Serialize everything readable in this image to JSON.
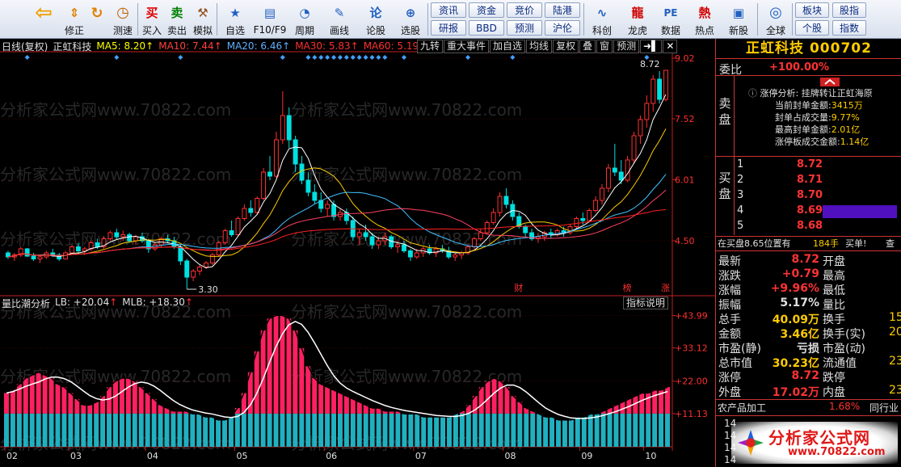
{
  "toolbar": {
    "buttons": [
      {
        "label": "",
        "icon": "back-arrow-icon",
        "glyph": "⇦"
      },
      {
        "label": "修正",
        "icon": "up-down-arrows-icon",
        "glyph": "⇕"
      },
      {
        "label": "测速",
        "icon": "refresh-circle-icon",
        "glyph": "↻"
      },
      {
        "label": "测速",
        "icon": "clock-icon",
        "glyph": "◷"
      },
      {
        "label": "买入",
        "icon": "buy-icon",
        "glyph": "买"
      },
      {
        "label": "卖出",
        "icon": "sell-icon",
        "glyph": "卖"
      },
      {
        "label": "模拟",
        "icon": "hammer-icon",
        "glyph": "⚒"
      },
      {
        "label": "自选",
        "icon": "star-icon",
        "glyph": "★"
      },
      {
        "label": "F10/F9",
        "icon": "document-icon",
        "glyph": "▤"
      },
      {
        "label": "周期",
        "icon": "period-clock-icon",
        "glyph": "◔"
      },
      {
        "label": "画线",
        "icon": "pencil-icon",
        "glyph": "✎"
      },
      {
        "label": "论股",
        "icon": "discuss-icon",
        "glyph": "论"
      },
      {
        "label": "选股",
        "icon": "magnifier-icon",
        "glyph": "⊕"
      },
      {
        "label": "科创",
        "icon": "chart-icon",
        "glyph": "∿"
      },
      {
        "label": "龙虎",
        "icon": "dragon-icon",
        "glyph": "龍"
      },
      {
        "label": "数据",
        "icon": "pe-icon",
        "glyph": "PE"
      },
      {
        "label": "热点",
        "icon": "hot-icon",
        "glyph": "熱"
      },
      {
        "label": "新股",
        "icon": "new-stock-icon",
        "glyph": "▣"
      },
      {
        "label": "全球",
        "icon": "globe-icon",
        "glyph": "◎"
      }
    ],
    "small_buttons": [
      {
        "label": "资讯"
      },
      {
        "label": "资金"
      },
      {
        "label": "竞价"
      },
      {
        "label": "陆港"
      },
      {
        "label": "研报"
      },
      {
        "label": "BBD"
      },
      {
        "label": "预测"
      },
      {
        "label": "沪伦"
      },
      {
        "label": "板块"
      },
      {
        "label": "股指"
      },
      {
        "label": "个股"
      },
      {
        "label": "指数"
      }
    ]
  },
  "chart_data": [
    {
      "type": "candlestick",
      "period_label": "日线(复权)",
      "stock_name": "正虹科技",
      "ma": [
        {
          "name": "MA5",
          "value": "8.20",
          "color": "#ffff00"
        },
        {
          "name": "MA10",
          "value": "7.44",
          "color": "#ff4040"
        },
        {
          "name": "MA20",
          "value": "6.46",
          "color": "#60b0ff"
        },
        {
          "name": "MA30",
          "value": "5.83",
          "color": "#ff3030"
        },
        {
          "name": "MA60",
          "value": "5.19",
          "color": "#ff3030"
        }
      ],
      "y_ticks": [
        "9.02",
        "7.52",
        "6.01",
        "4.50"
      ],
      "x_ticks": [
        "02",
        "03",
        "04",
        "05",
        "06",
        "07",
        "08",
        "09",
        "10"
      ],
      "high_label": "8.72",
      "low_label": "3.30",
      "markers": [
        "财",
        "榜",
        "涨"
      ],
      "ylim": [
        3.2,
        9.1
      ],
      "points": [
        [
          0,
          4.2,
          4.25,
          4.05,
          4.1
        ],
        [
          1,
          4.1,
          4.2,
          4.0,
          4.15
        ],
        [
          2,
          4.15,
          4.35,
          4.1,
          4.3
        ],
        [
          3,
          4.3,
          4.32,
          4.1,
          4.12
        ],
        [
          4,
          4.12,
          4.2,
          4.0,
          4.05
        ],
        [
          5,
          4.05,
          4.15,
          3.95,
          4.1
        ],
        [
          6,
          4.1,
          4.25,
          4.05,
          4.2
        ],
        [
          7,
          4.2,
          4.3,
          4.1,
          4.15
        ],
        [
          8,
          4.15,
          4.2,
          4.0,
          4.05
        ],
        [
          9,
          4.05,
          4.25,
          4.05,
          4.2
        ],
        [
          10,
          4.2,
          4.4,
          4.15,
          4.35
        ],
        [
          11,
          4.35,
          4.45,
          4.2,
          4.25
        ],
        [
          12,
          4.25,
          4.35,
          4.15,
          4.3
        ],
        [
          13,
          4.3,
          4.5,
          4.25,
          4.45
        ],
        [
          14,
          4.45,
          4.55,
          4.3,
          4.35
        ],
        [
          15,
          4.35,
          4.6,
          4.3,
          4.55
        ],
        [
          16,
          4.55,
          4.75,
          4.5,
          4.7
        ],
        [
          17,
          4.7,
          4.8,
          4.55,
          4.6
        ],
        [
          18,
          4.6,
          4.75,
          4.5,
          4.65
        ],
        [
          19,
          4.65,
          4.7,
          4.45,
          4.5
        ],
        [
          20,
          4.5,
          4.65,
          4.4,
          4.6
        ],
        [
          21,
          4.6,
          4.7,
          4.45,
          4.5
        ],
        [
          22,
          4.5,
          4.55,
          4.2,
          4.3
        ],
        [
          23,
          4.3,
          4.45,
          4.25,
          4.4
        ],
        [
          24,
          4.4,
          4.6,
          4.35,
          4.55
        ],
        [
          25,
          4.55,
          4.65,
          4.45,
          4.5
        ],
        [
          26,
          4.5,
          4.6,
          4.3,
          4.35
        ],
        [
          27,
          4.35,
          4.4,
          3.9,
          4.0
        ],
        [
          28,
          4.0,
          4.05,
          3.3,
          3.6
        ],
        [
          29,
          3.6,
          3.8,
          3.5,
          3.75
        ],
        [
          30,
          3.75,
          3.9,
          3.65,
          3.85
        ],
        [
          31,
          3.85,
          4.0,
          3.8,
          3.95
        ],
        [
          32,
          3.95,
          4.2,
          3.9,
          4.15
        ],
        [
          33,
          4.15,
          4.5,
          4.1,
          4.45
        ],
        [
          34,
          4.45,
          4.8,
          4.4,
          4.75
        ],
        [
          35,
          4.75,
          5.0,
          4.6,
          4.65
        ],
        [
          36,
          4.65,
          5.1,
          4.6,
          5.05
        ],
        [
          37,
          5.05,
          5.4,
          5.0,
          5.3
        ],
        [
          38,
          5.3,
          5.5,
          5.1,
          5.2
        ],
        [
          39,
          5.2,
          5.6,
          5.15,
          5.55
        ],
        [
          40,
          5.55,
          6.3,
          5.5,
          6.2
        ],
        [
          41,
          6.2,
          6.6,
          6.0,
          6.1
        ],
        [
          42,
          6.1,
          7.2,
          6.05,
          7.0
        ],
        [
          43,
          7.0,
          8.2,
          6.9,
          7.6
        ],
        [
          44,
          7.6,
          7.8,
          6.8,
          7.0
        ],
        [
          45,
          7.0,
          7.1,
          6.2,
          6.4
        ],
        [
          46,
          6.4,
          6.6,
          5.9,
          6.0
        ],
        [
          47,
          6.0,
          6.2,
          5.6,
          5.7
        ],
        [
          48,
          5.7,
          5.9,
          5.4,
          5.5
        ],
        [
          49,
          5.5,
          5.7,
          5.2,
          5.3
        ],
        [
          50,
          5.3,
          5.5,
          5.1,
          5.4
        ],
        [
          51,
          5.4,
          5.5,
          5.0,
          5.1
        ],
        [
          52,
          5.1,
          5.3,
          5.0,
          5.2
        ],
        [
          53,
          5.2,
          5.3,
          4.9,
          5.0
        ],
        [
          54,
          5.0,
          5.1,
          4.5,
          4.6
        ],
        [
          55,
          4.6,
          4.8,
          4.4,
          4.7
        ],
        [
          56,
          4.7,
          4.9,
          4.5,
          4.6
        ],
        [
          57,
          4.6,
          4.7,
          4.3,
          4.4
        ],
        [
          58,
          4.4,
          4.6,
          4.3,
          4.5
        ],
        [
          59,
          4.5,
          4.7,
          4.4,
          4.6
        ],
        [
          60,
          4.6,
          4.65,
          4.3,
          4.35
        ],
        [
          61,
          4.35,
          4.5,
          4.2,
          4.4
        ],
        [
          62,
          4.4,
          4.5,
          4.2,
          4.25
        ],
        [
          63,
          4.25,
          4.3,
          4.0,
          4.1
        ],
        [
          64,
          4.1,
          4.3,
          4.05,
          4.2
        ],
        [
          65,
          4.2,
          4.35,
          4.1,
          4.3
        ],
        [
          66,
          4.3,
          4.4,
          4.15,
          4.2
        ],
        [
          67,
          4.2,
          4.35,
          4.1,
          4.3
        ],
        [
          68,
          4.3,
          4.4,
          4.2,
          4.25
        ],
        [
          69,
          4.25,
          4.35,
          4.05,
          4.1
        ],
        [
          70,
          4.1,
          4.2,
          4.0,
          4.15
        ],
        [
          71,
          4.15,
          4.25,
          4.05,
          4.2
        ],
        [
          72,
          4.2,
          4.4,
          4.15,
          4.35
        ],
        [
          73,
          4.35,
          4.6,
          4.3,
          4.55
        ],
        [
          74,
          4.55,
          4.8,
          4.5,
          4.7
        ],
        [
          75,
          4.7,
          5.0,
          4.65,
          4.95
        ],
        [
          76,
          4.95,
          5.3,
          4.9,
          5.2
        ],
        [
          77,
          5.2,
          5.7,
          5.1,
          5.6
        ],
        [
          78,
          5.6,
          5.8,
          5.3,
          5.4
        ],
        [
          79,
          5.4,
          5.5,
          5.0,
          5.1
        ],
        [
          80,
          5.1,
          5.2,
          4.8,
          4.85
        ],
        [
          81,
          4.85,
          4.9,
          4.6,
          4.7
        ],
        [
          82,
          4.7,
          4.8,
          4.5,
          4.55
        ],
        [
          83,
          4.55,
          4.7,
          4.45,
          4.6
        ],
        [
          84,
          4.6,
          4.75,
          4.5,
          4.7
        ],
        [
          85,
          4.7,
          4.8,
          4.55,
          4.65
        ],
        [
          86,
          4.65,
          4.8,
          4.6,
          4.75
        ],
        [
          87,
          4.75,
          4.85,
          4.6,
          4.7
        ],
        [
          88,
          4.7,
          4.9,
          4.65,
          4.85
        ],
        [
          89,
          4.85,
          5.1,
          4.8,
          5.05
        ],
        [
          90,
          5.05,
          5.2,
          4.9,
          5.0
        ],
        [
          91,
          5.0,
          5.3,
          4.95,
          5.25
        ],
        [
          92,
          5.25,
          5.6,
          5.2,
          5.5
        ],
        [
          93,
          5.5,
          5.9,
          5.4,
          5.8
        ],
        [
          94,
          5.8,
          6.4,
          5.7,
          6.3
        ],
        [
          95,
          6.3,
          6.9,
          6.1,
          6.2
        ],
        [
          96,
          6.2,
          6.5,
          5.9,
          6.0
        ],
        [
          97,
          6.0,
          6.6,
          5.95,
          6.5
        ],
        [
          98,
          6.5,
          7.2,
          6.4,
          7.1
        ],
        [
          99,
          7.1,
          7.6,
          6.9,
          7.5
        ],
        [
          100,
          7.5,
          8.1,
          7.3,
          7.9
        ],
        [
          101,
          7.9,
          8.6,
          7.7,
          8.5
        ],
        [
          102,
          8.5,
          8.7,
          7.9,
          8.0
        ],
        [
          103,
          8.0,
          8.72,
          7.95,
          8.72
        ]
      ]
    },
    {
      "type": "bar",
      "name": "量比潮分析",
      "series": [
        {
          "name": "LB",
          "value": "+20.04",
          "color": "#ffffff"
        },
        {
          "name": "MLB",
          "value": "+18.30",
          "color": "#ffffff"
        }
      ],
      "y_ticks": [
        "+43.99",
        "+33.12",
        "+22.00",
        "+11.13"
      ],
      "ylim": [
        0,
        46
      ],
      "values": [
        18,
        19,
        21,
        23,
        24,
        25,
        24,
        23,
        21,
        20,
        18,
        16,
        14,
        14,
        15,
        17,
        20,
        22,
        23,
        23,
        22,
        20,
        18,
        16,
        14,
        13,
        12,
        12,
        12,
        11,
        11,
        10,
        10,
        9,
        9,
        10,
        13,
        18,
        25,
        32,
        39,
        43,
        44,
        44,
        43,
        39,
        33,
        27,
        23,
        21,
        20,
        19,
        18,
        17,
        16,
        15,
        14,
        13,
        13,
        12,
        12,
        12,
        11,
        11,
        11,
        10,
        10,
        10,
        10,
        10,
        11,
        12,
        14,
        17,
        20,
        22,
        23,
        22,
        20,
        17,
        15,
        13,
        12,
        11,
        10,
        10,
        9,
        9,
        9,
        10,
        10,
        11,
        11,
        12,
        13,
        14,
        15,
        16,
        17,
        18,
        18,
        19,
        19,
        20
      ]
    }
  ],
  "func_buttons": [
    "九转",
    "重大事件",
    "加自选",
    "均线",
    "复权",
    "叠",
    "窗",
    "预测"
  ],
  "indicator_help": "指标说明",
  "panel": {
    "title": "正虹科技 000702",
    "weibi_label": "委比",
    "weibi_value": "+100.00%",
    "zt_title": "涨停分析: 挂牌转让正虹海原",
    "zt_lines": [
      {
        "label": "当前封单金额:",
        "value": "3415万"
      },
      {
        "label": "封单占成交量:",
        "value": "9.77%"
      },
      {
        "label": "最高封单金额:",
        "value": "2.01亿"
      },
      {
        "label": "涨停板成交金额:",
        "value": "1.14亿"
      }
    ],
    "sell_label": "卖盘",
    "buy_label": "买盘",
    "bids": [
      {
        "level": "1",
        "price": "8.72"
      },
      {
        "level": "2",
        "price": "8.71"
      },
      {
        "level": "3",
        "price": "8.70"
      },
      {
        "level": "4",
        "price": "8.69"
      },
      {
        "level": "5",
        "price": "8.68"
      }
    ],
    "queue_text": "在买盘8.65位置有",
    "queue_count": "184手",
    "queue_action": "买单!",
    "queue_check": "查",
    "quotes": [
      {
        "l": "最新",
        "v": "8.72",
        "l2": "开盘",
        "v2": "",
        "vc": "red"
      },
      {
        "l": "涨跌",
        "v": "+0.79",
        "l2": "最高",
        "v2": "",
        "vc": "red"
      },
      {
        "l": "涨幅",
        "v": "+9.96%",
        "l2": "最低",
        "v2": "",
        "vc": "red"
      },
      {
        "l": "振幅",
        "v": "5.17%",
        "l2": "量比",
        "v2": "",
        "vc": "white"
      },
      {
        "l": "总手",
        "v": "40.09万",
        "l2": "换手",
        "v2": "15",
        "vc": "yellow"
      },
      {
        "l": "金额",
        "v": "3.46亿",
        "l2": "换手(实)",
        "v2": "20",
        "vc": "yellow"
      },
      {
        "l": "市盈(静)",
        "v": "亏损",
        "l2": "市盈(动)",
        "v2": "",
        "vc": "white"
      },
      {
        "l": "总市值",
        "v": "30.23亿",
        "l2": "流通值",
        "v2": "23",
        "vc": "yellow"
      },
      {
        "l": "涨停",
        "v": "8.72",
        "l2": "跌停",
        "v2": "",
        "vc": "red"
      },
      {
        "l": "外盘",
        "v": "17.02万",
        "l2": "内盘",
        "v2": "23",
        "vc": "red"
      }
    ],
    "sector_name": "农产品加工",
    "sector_change": "1.68%",
    "sector_link": "同行业",
    "tick_rows": [
      {
        "time": "14"
      },
      {
        "time": "14"
      },
      {
        "time": "14"
      },
      {
        "time": "14"
      }
    ]
  },
  "watermark": "分析家公式网www.70822.com",
  "brand": {
    "name": "分析家公式网",
    "url": "www.70822.com"
  }
}
